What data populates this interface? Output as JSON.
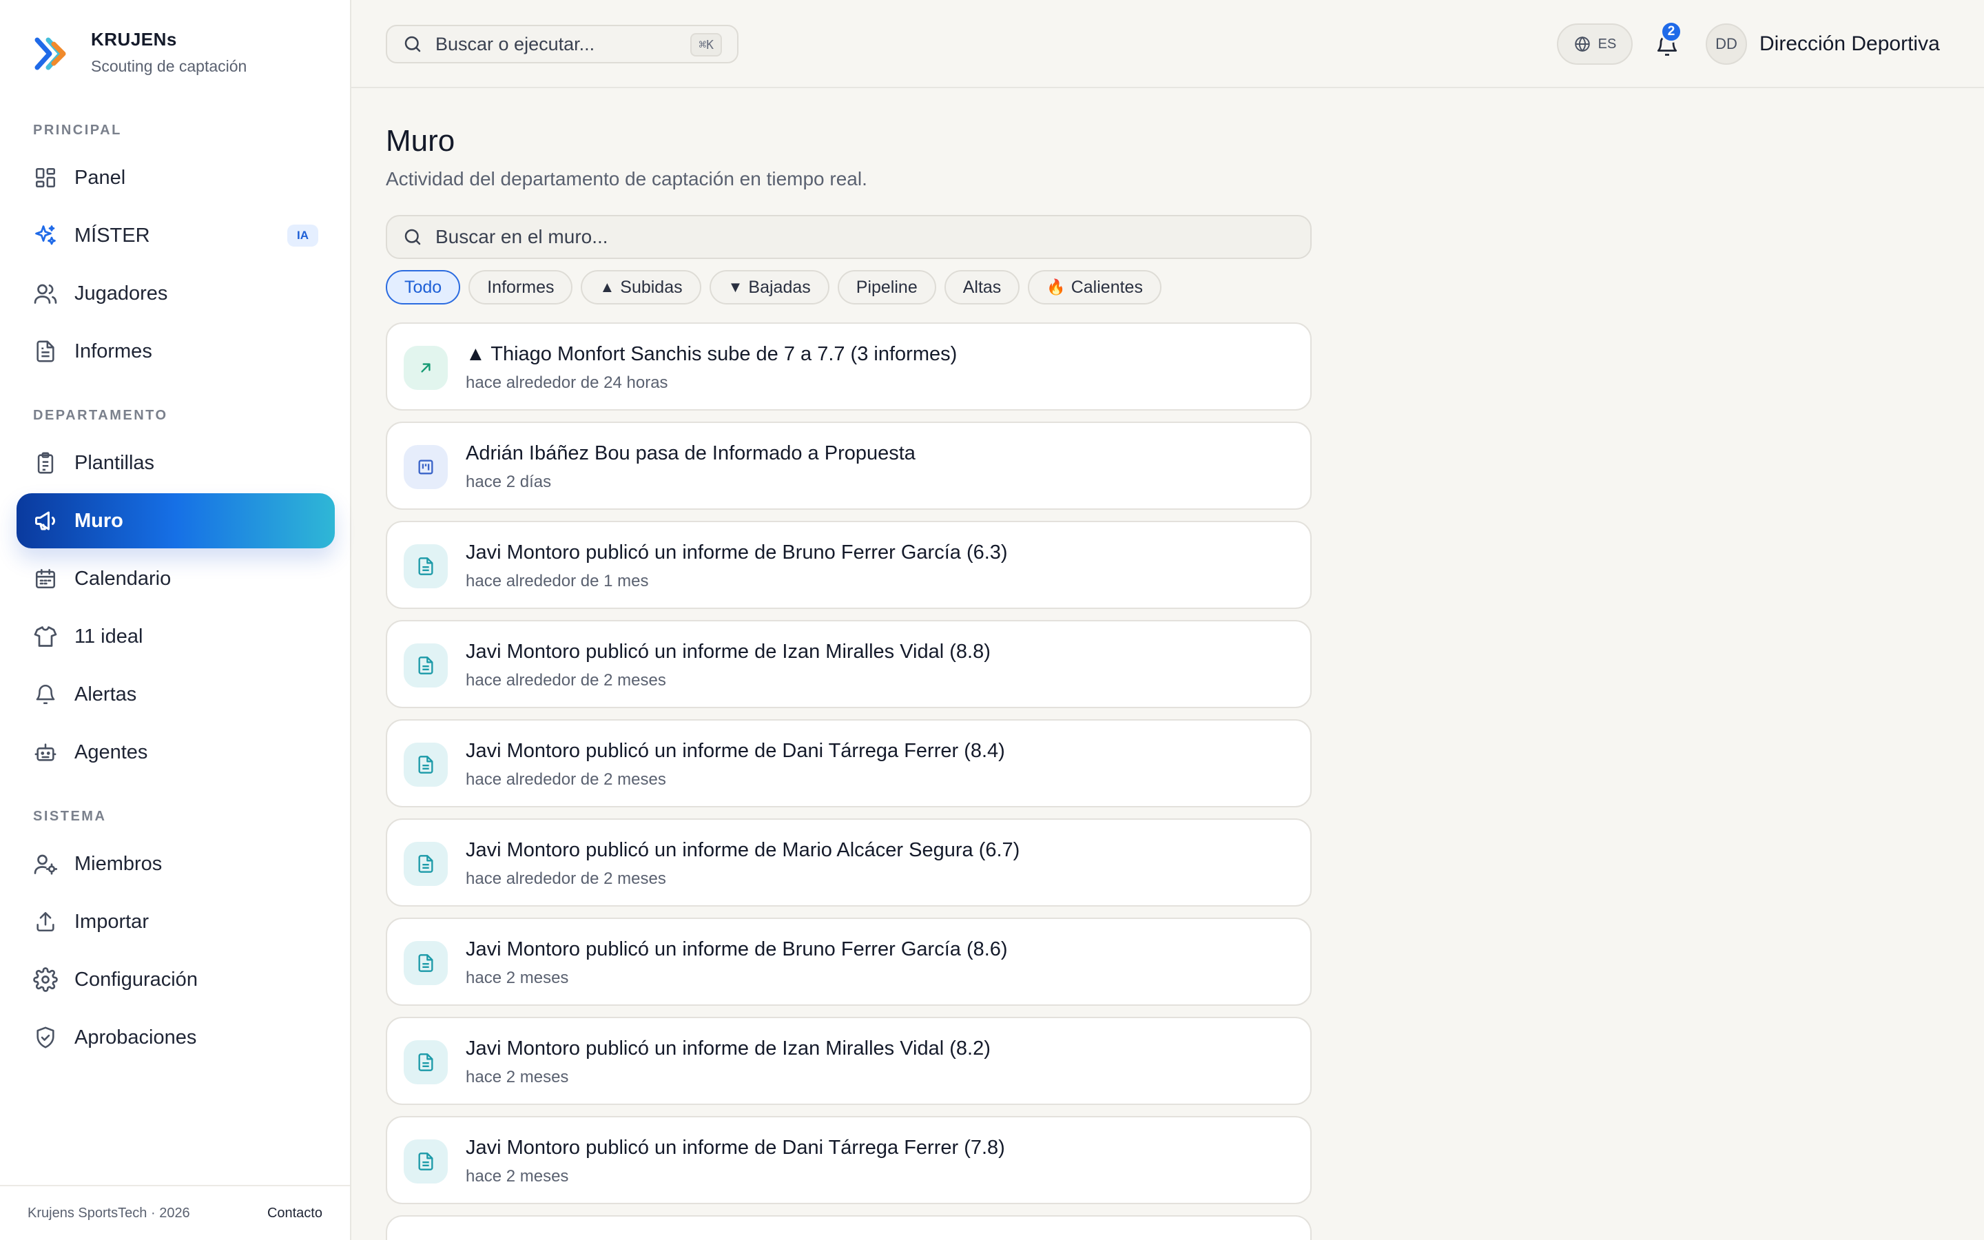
{
  "brand": {
    "name": "KRUJENs",
    "subtitle": "Scouting de captación"
  },
  "sidebar": {
    "sections": {
      "principal": "PRINCIPAL",
      "departamento": "DEPARTAMENTO",
      "sistema": "SISTEMA"
    },
    "items": [
      {
        "label": "Panel",
        "icon": "grid-icon"
      },
      {
        "label": "MÍSTER",
        "icon": "sparkles-icon",
        "badge": "IA"
      },
      {
        "label": "Jugadores",
        "icon": "users-icon"
      },
      {
        "label": "Informes",
        "icon": "document-icon"
      },
      {
        "label": "Plantillas",
        "icon": "clipboard-icon"
      },
      {
        "label": "Muro",
        "icon": "megaphone-icon",
        "active": true
      },
      {
        "label": "Calendario",
        "icon": "calendar-icon"
      },
      {
        "label": "11 ideal",
        "icon": "shirt-icon"
      },
      {
        "label": "Alertas",
        "icon": "bell-icon"
      },
      {
        "label": "Agentes",
        "icon": "bot-icon"
      },
      {
        "label": "Miembros",
        "icon": "user-gear-icon"
      },
      {
        "label": "Importar",
        "icon": "upload-icon"
      },
      {
        "label": "Configuración",
        "icon": "gear-icon"
      },
      {
        "label": "Aprobaciones",
        "icon": "shield-check-icon"
      }
    ],
    "footer": {
      "copyright": "Krujens SportsTech · 2026",
      "contact": "Contacto"
    }
  },
  "topbar": {
    "search_placeholder": "Buscar o ejecutar...",
    "shortcut": "⌘K",
    "language": "ES",
    "notifications_count": "2",
    "user_initials": "DD",
    "user_name": "Dirección Deportiva"
  },
  "page": {
    "title": "Muro",
    "subtitle": "Actividad del departamento de captación en tiempo real.",
    "search_placeholder": "Buscar en el muro..."
  },
  "filters": [
    {
      "label": "Todo",
      "active": true
    },
    {
      "label": "Informes"
    },
    {
      "label": "Subidas",
      "prefix": "▲"
    },
    {
      "label": "Bajadas",
      "prefix": "▼"
    },
    {
      "label": "Pipeline"
    },
    {
      "label": "Altas"
    },
    {
      "label": "Calientes",
      "prefix": "🔥"
    }
  ],
  "feed": [
    {
      "type": "up",
      "icon": "arrow-up-right-icon",
      "title": "▲ Thiago Monfort Sanchis sube de 7 a 7.7 (3 informes)",
      "time": "hace alrededor de 24 horas"
    },
    {
      "type": "pipe",
      "icon": "kanban-icon",
      "title": "Adrián Ibáñez Bou pasa de Informado a Propuesta",
      "time": "hace 2 días"
    },
    {
      "type": "rep",
      "icon": "report-icon",
      "title": "Javi Montoro publicó un informe de Bruno Ferrer García (6.3)",
      "time": "hace alrededor de 1 mes"
    },
    {
      "type": "rep",
      "icon": "report-icon",
      "title": "Javi Montoro publicó un informe de Izan Miralles Vidal (8.8)",
      "time": "hace alrededor de 2 meses"
    },
    {
      "type": "rep",
      "icon": "report-icon",
      "title": "Javi Montoro publicó un informe de Dani Tárrega Ferrer (8.4)",
      "time": "hace alrededor de 2 meses"
    },
    {
      "type": "rep",
      "icon": "report-icon",
      "title": "Javi Montoro publicó un informe de Mario Alcácer Segura (6.7)",
      "time": "hace alrededor de 2 meses"
    },
    {
      "type": "rep",
      "icon": "report-icon",
      "title": "Javi Montoro publicó un informe de Bruno Ferrer García (8.6)",
      "time": "hace 2 meses"
    },
    {
      "type": "rep",
      "icon": "report-icon",
      "title": "Javi Montoro publicó un informe de Izan Miralles Vidal (8.2)",
      "time": "hace 2 meses"
    },
    {
      "type": "rep",
      "icon": "report-icon",
      "title": "Javi Montoro publicó un informe de Dani Tárrega Ferrer (7.8)",
      "time": "hace 2 meses"
    }
  ]
}
